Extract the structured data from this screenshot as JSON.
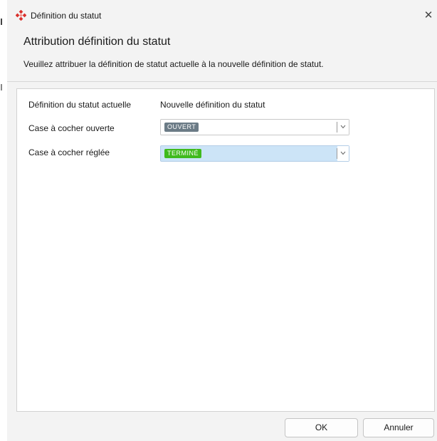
{
  "window": {
    "title": "Définition du statut",
    "close_glyph": "✕",
    "app_icon": "red-diamond-logo-icon"
  },
  "header": {
    "title": "Attribution définition du statut",
    "description": "Veuillez attribuer la définition de statut actuelle à la nouvelle définition de statut."
  },
  "mapping": {
    "col_current": "Définition du statut actuelle",
    "col_new": "Nouvelle définition du statut",
    "rows": [
      {
        "label": "Case à cocher ouverte",
        "value": "OUVERT",
        "badge_color": "#6b7b86",
        "selected": false
      },
      {
        "label": "Case à cocher réglée",
        "value": "TERMINÉ",
        "badge_color": "#3fba1d",
        "selected": true
      }
    ]
  },
  "buttons": {
    "ok": "OK",
    "cancel": "Annuler"
  },
  "colors": {
    "accent_red": "#d9302c",
    "selection_bg": "#cce4f7"
  }
}
